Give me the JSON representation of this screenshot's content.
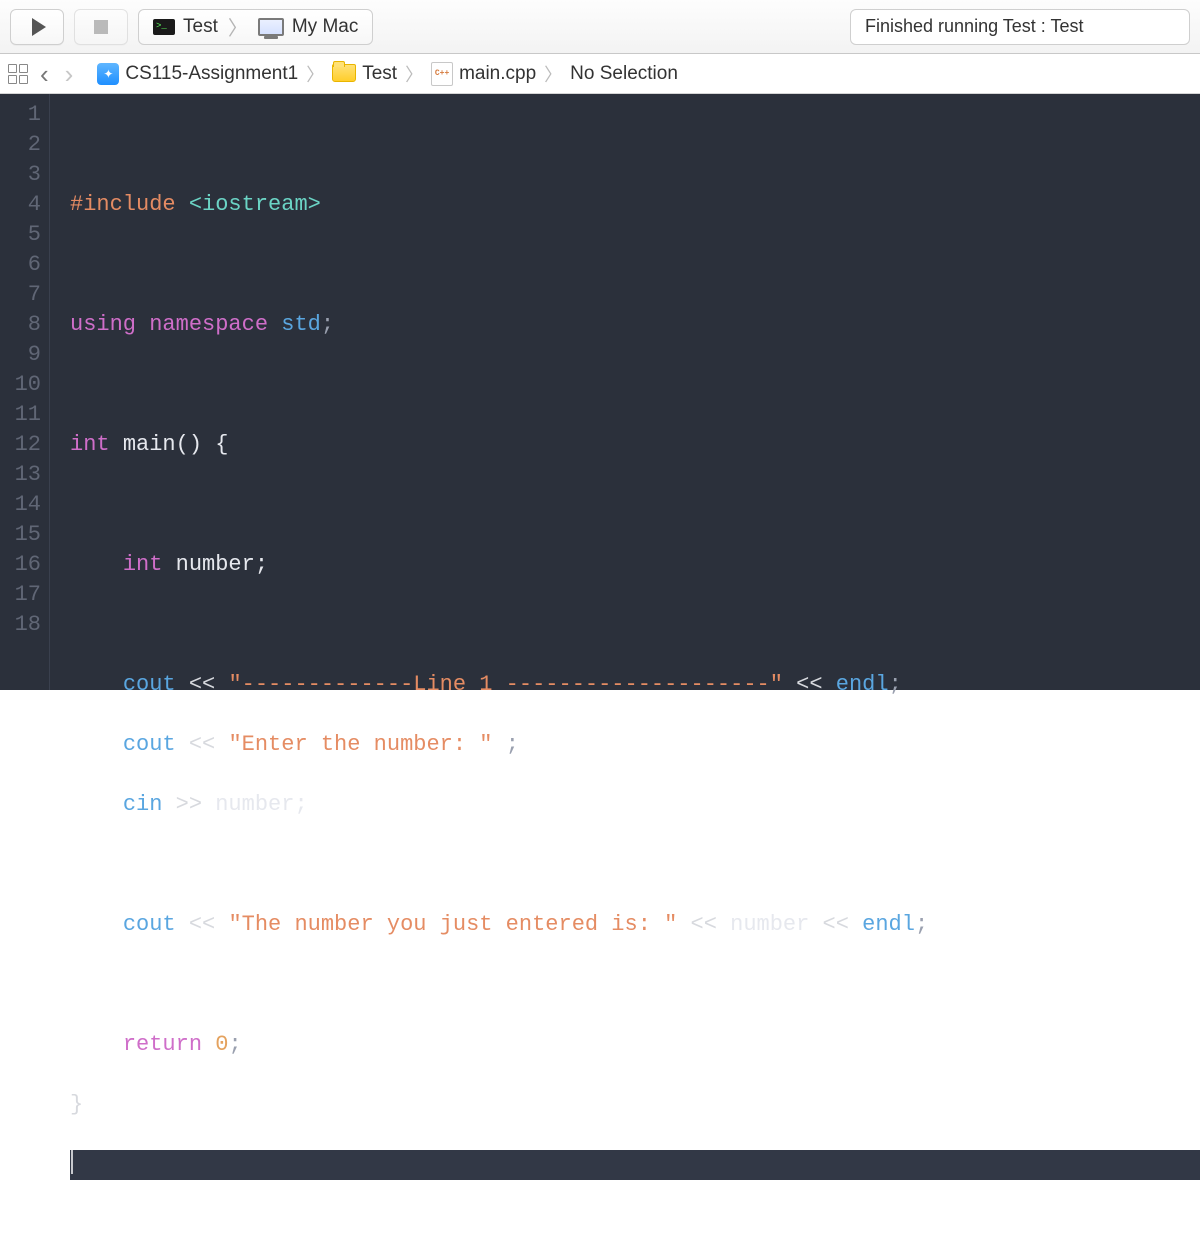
{
  "toolbar": {
    "scheme_name": "Test",
    "destination": "My Mac",
    "status_text": "Finished running Test : Test"
  },
  "breadcrumb": {
    "project": "CS115-Assignment1",
    "folder": "Test",
    "file": "main.cpp",
    "selection": "No Selection"
  },
  "editor": {
    "line_numbers": [
      "1",
      "2",
      "3",
      "4",
      "5",
      "6",
      "7",
      "8",
      "9",
      "10",
      "11",
      "12",
      "13",
      "14",
      "15",
      "16",
      "17",
      "18"
    ],
    "current_line": 18,
    "code": {
      "l2_include": "#include",
      "l2_header": "<iostream>",
      "l4_using": "using",
      "l4_namespace": "namespace",
      "l4_std": "std",
      "l6_int": "int",
      "l6_main": "main() {",
      "l8_int": "int",
      "l8_var": "number;",
      "l10_cout": "cout",
      "l10_op": "<<",
      "l10_str": "\"-------------Line 1 --------------------\"",
      "l10_op2": "<<",
      "l10_endl": "endl",
      "l11_cout": "cout",
      "l11_op": "<<",
      "l11_str": "\"Enter the number: \"",
      "l11_semi": ";",
      "l12_cin": "cin",
      "l12_op": ">>",
      "l12_var": "number;",
      "l14_cout": "cout",
      "l14_op": "<<",
      "l14_str": "\"The number you just entered is: \"",
      "l14_op2": "<<",
      "l14_var": "number",
      "l14_op3": "<<",
      "l14_endl": "endl",
      "l16_return": "return",
      "l16_val": "0",
      "l17_brace": "}"
    }
  }
}
